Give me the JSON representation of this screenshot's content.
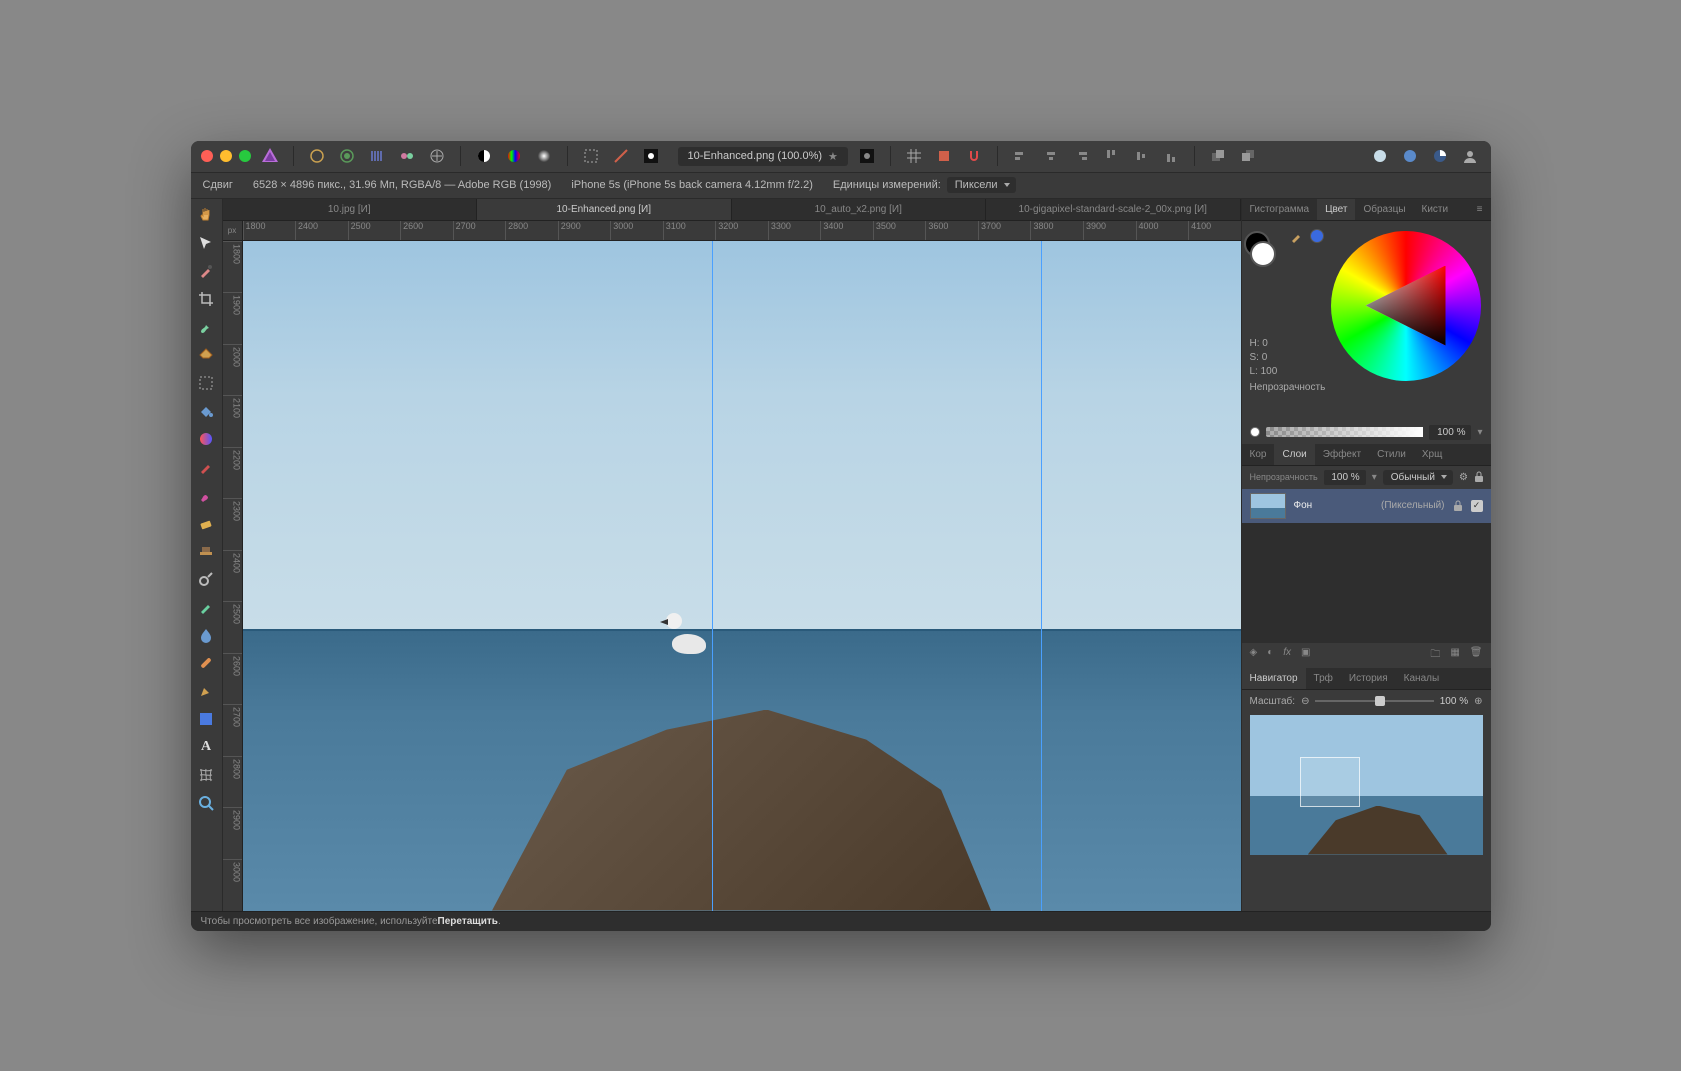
{
  "window": {
    "doc_title": "10-Enhanced.png (100.0%)",
    "modified_marker": "★"
  },
  "infobar": {
    "tool_label": "Сдвиг",
    "dimensions": "6528 × 4896 пикс., 31.96 Мп, RGBA/8 — Adobe RGB (1998)",
    "camera": "iPhone 5s (iPhone 5s back camera 4.12mm f/2.2)",
    "units_label": "Единицы измерений:",
    "units_value": "Пиксели"
  },
  "tabs": [
    {
      "label": "10.jpg [И]",
      "active": false
    },
    {
      "label": "10-Enhanced.png [И]",
      "active": true
    },
    {
      "label": "10_auto_x2.png [И]",
      "active": false
    },
    {
      "label": "10-gigapixel-standard-scale-2_00x.png [И]",
      "active": false
    }
  ],
  "ruler": {
    "unit": "px",
    "h": [
      "1800",
      "2400",
      "2500",
      "2600",
      "2700",
      "2800",
      "2900",
      "3000",
      "3100",
      "3200",
      "3300",
      "3400",
      "3500",
      "3600",
      "3700",
      "3800",
      "3900",
      "4000",
      "4100"
    ],
    "v": [
      "1800",
      "1900",
      "2000",
      "2100",
      "2200",
      "2300",
      "2400",
      "2500",
      "2600",
      "2700",
      "2800",
      "2900",
      "3000"
    ]
  },
  "right": {
    "color_tabs": [
      "Гистограмма",
      "Цвет",
      "Образцы",
      "Кисти"
    ],
    "color_active": "Цвет",
    "hsl": {
      "h": "H: 0",
      "s": "S: 0",
      "l": "L: 100"
    },
    "opacity_label": "Непрозрачность",
    "opacity_value": "100 %",
    "layer_tabs": [
      "Кор",
      "Слои",
      "Эффект",
      "Стили",
      "Хрщ"
    ],
    "layer_active": "Слои",
    "layer_opacity_label": "Непрозрачность",
    "layer_opacity_value": "100 %",
    "blend_mode": "Обычный",
    "layer": {
      "name": "Фон",
      "type": "(Пиксельный)"
    },
    "nav_tabs": [
      "Навигатор",
      "Трф",
      "История",
      "Каналы"
    ],
    "nav_active": "Навигатор",
    "zoom_label": "Масштаб:",
    "zoom_value": "100 %"
  },
  "status": {
    "hint_pre": "Чтобы просмотреть все изображение, используйте ",
    "hint_bold": "Перетащить",
    "hint_post": "."
  },
  "colors": {
    "traffic": {
      "close": "#ff5f56",
      "min": "#ffbd2e",
      "max": "#27c93f"
    },
    "accent": "#4aa0ff"
  }
}
